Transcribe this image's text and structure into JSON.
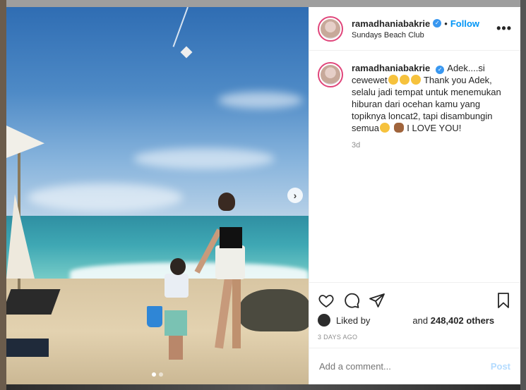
{
  "post": {
    "username": "ramadhaniabakrie",
    "verified_icon": "verified-badge-icon",
    "separator": "•",
    "follow_label": "Follow",
    "location": "Sundays Beach Club",
    "more_label": "•••"
  },
  "caption": {
    "username": "ramadhaniabakrie",
    "text_part1": "Adek....si cewewet",
    "text_part2": " Thank you Adek, selalu jadi tempat untuk menemukan hiburan dari ocehan kamu yang topiknya loncat2, tapi disambungin semua",
    "text_part3": " I LOVE YOU!",
    "time_ago": "3d"
  },
  "likes": {
    "liked_by_label": "Liked by",
    "and_label": "and",
    "count": "248,402 others"
  },
  "date_label": "3 DAYS AGO",
  "comment_box": {
    "placeholder": "Add a comment...",
    "post_label": "Post"
  },
  "carousel": {
    "next_arrow": "›",
    "slides_total": 2,
    "active_slide": 1
  },
  "colors": {
    "accent_blue": "#0095f6",
    "post_disabled": "#b3dbff",
    "verified": "#3897f0"
  },
  "icons": [
    "heart-icon",
    "comment-icon",
    "share-icon",
    "bookmark-icon",
    "more-options-icon",
    "next-arrow-icon"
  ]
}
